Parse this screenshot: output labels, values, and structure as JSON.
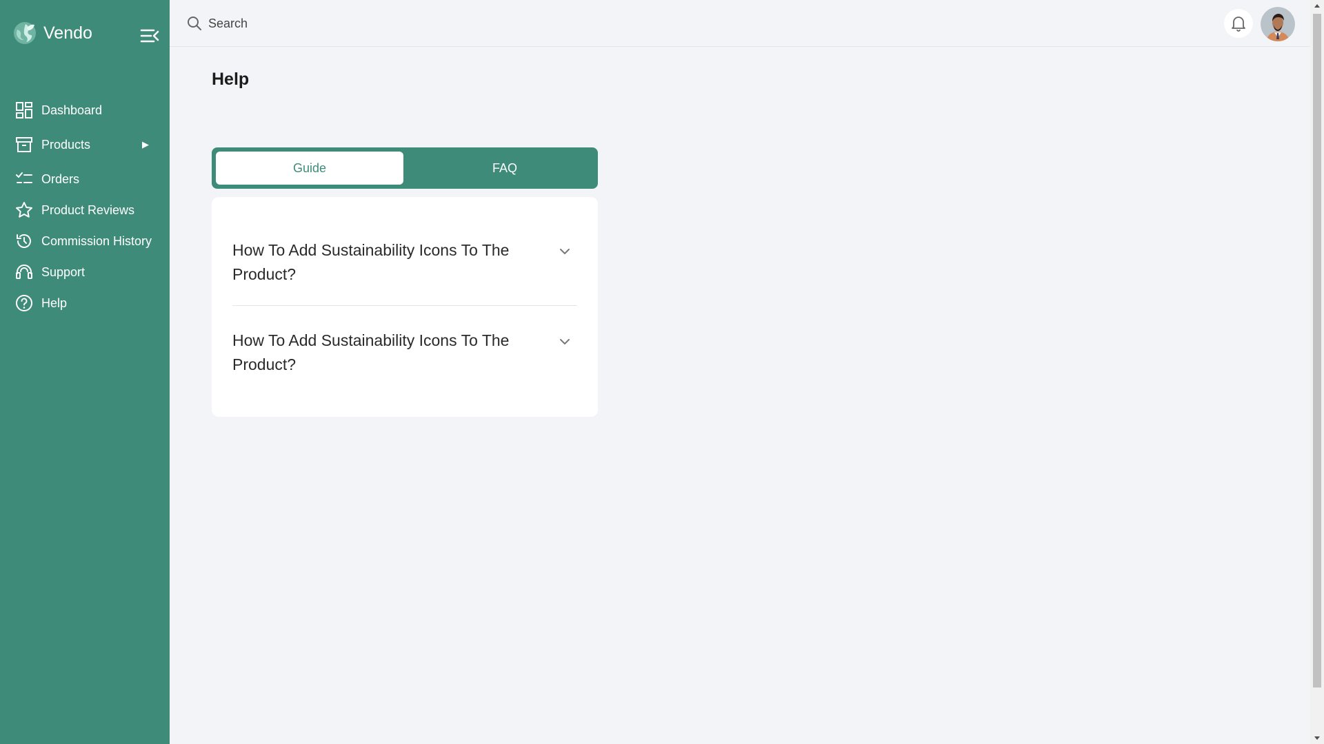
{
  "brand": {
    "name": "Vendo",
    "logo_icon": "globe-leaf-logo",
    "accent": "#3e8b79"
  },
  "sidebar": {
    "items": [
      {
        "label": "Dashboard",
        "icon": "dashboard-icon"
      },
      {
        "label": "Products",
        "icon": "archive-box-icon",
        "arrow": "▶"
      },
      {
        "label": "Orders",
        "icon": "checklist-icon"
      },
      {
        "label": "Product Reviews",
        "icon": "star-icon"
      },
      {
        "label": "Commission History",
        "icon": "history-icon"
      },
      {
        "label": "Support",
        "icon": "headset-icon"
      },
      {
        "label": "Help",
        "icon": "question-circle-icon"
      }
    ]
  },
  "topbar": {
    "search_placeholder": "Search",
    "search_value": ""
  },
  "page": {
    "title": "Help",
    "tabs": [
      {
        "label": "Guide",
        "active": true
      },
      {
        "label": "FAQ",
        "active": false
      }
    ],
    "faq": [
      {
        "question": "How To Add Sustainability Icons To The Product?"
      },
      {
        "question": "How To Add Sustainability Icons To The Product?"
      }
    ]
  },
  "colors": {
    "sidebar_bg": "#3e8b79",
    "page_bg": "#f3f4f7",
    "card_bg": "#ffffff"
  }
}
